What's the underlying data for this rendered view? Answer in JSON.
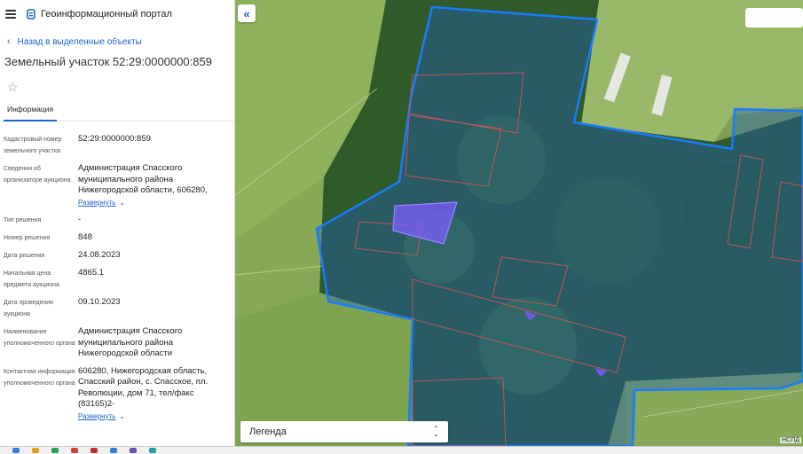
{
  "app": {
    "title": "Геоинформационный портал"
  },
  "nav": {
    "back_label": "Назад в выделенные объекты"
  },
  "object": {
    "title": "Земельный участок 52:29:0000000:859"
  },
  "tabs": [
    {
      "label": "Информация"
    }
  ],
  "details": [
    {
      "label": "Кадастровый номер земельного участка",
      "value": "52:29:0000000:859"
    },
    {
      "label": "Сведения об организаторе аукциона",
      "value": "Администрация Спасского муниципального района Нижегородской области, 606280,",
      "expand": "Развернуть"
    },
    {
      "label": "Тип решения",
      "value": "-"
    },
    {
      "label": "Номер решения",
      "value": "848"
    },
    {
      "label": "Дата решения",
      "value": "24.08.2023"
    },
    {
      "label": "Начальная цена предмета аукциона",
      "value": "4865.1"
    },
    {
      "label": "Дата проведения аукциона",
      "value": "09.10.2023"
    },
    {
      "label": "Наименование уполномоченного органа",
      "value": "Администрация Спасского муниципального района Нижегородской области"
    },
    {
      "label": "Контактная информация уполномоченного органа",
      "value": "606280, Нижегородская область, Спасский район, с. Спасское, пл. Революции, дом 71, тел/факс (83165)2-",
      "expand": "Развернуть"
    }
  ],
  "map": {
    "legend_label": "Легенда",
    "attribution": "НСПД",
    "colors": {
      "boundary": "#1a7bff",
      "parcel_fill": "#7b5cff",
      "parcel_outline": "#c0565a"
    }
  },
  "icons": {
    "menu": "hamburger-icon",
    "logo": "portal-logo-icon",
    "back": "chevron-left-icon",
    "star": "star-icon",
    "expand": "chevron-down-icon",
    "collapse": "double-chevron-left-icon",
    "legend": "updown-arrows-icon"
  }
}
